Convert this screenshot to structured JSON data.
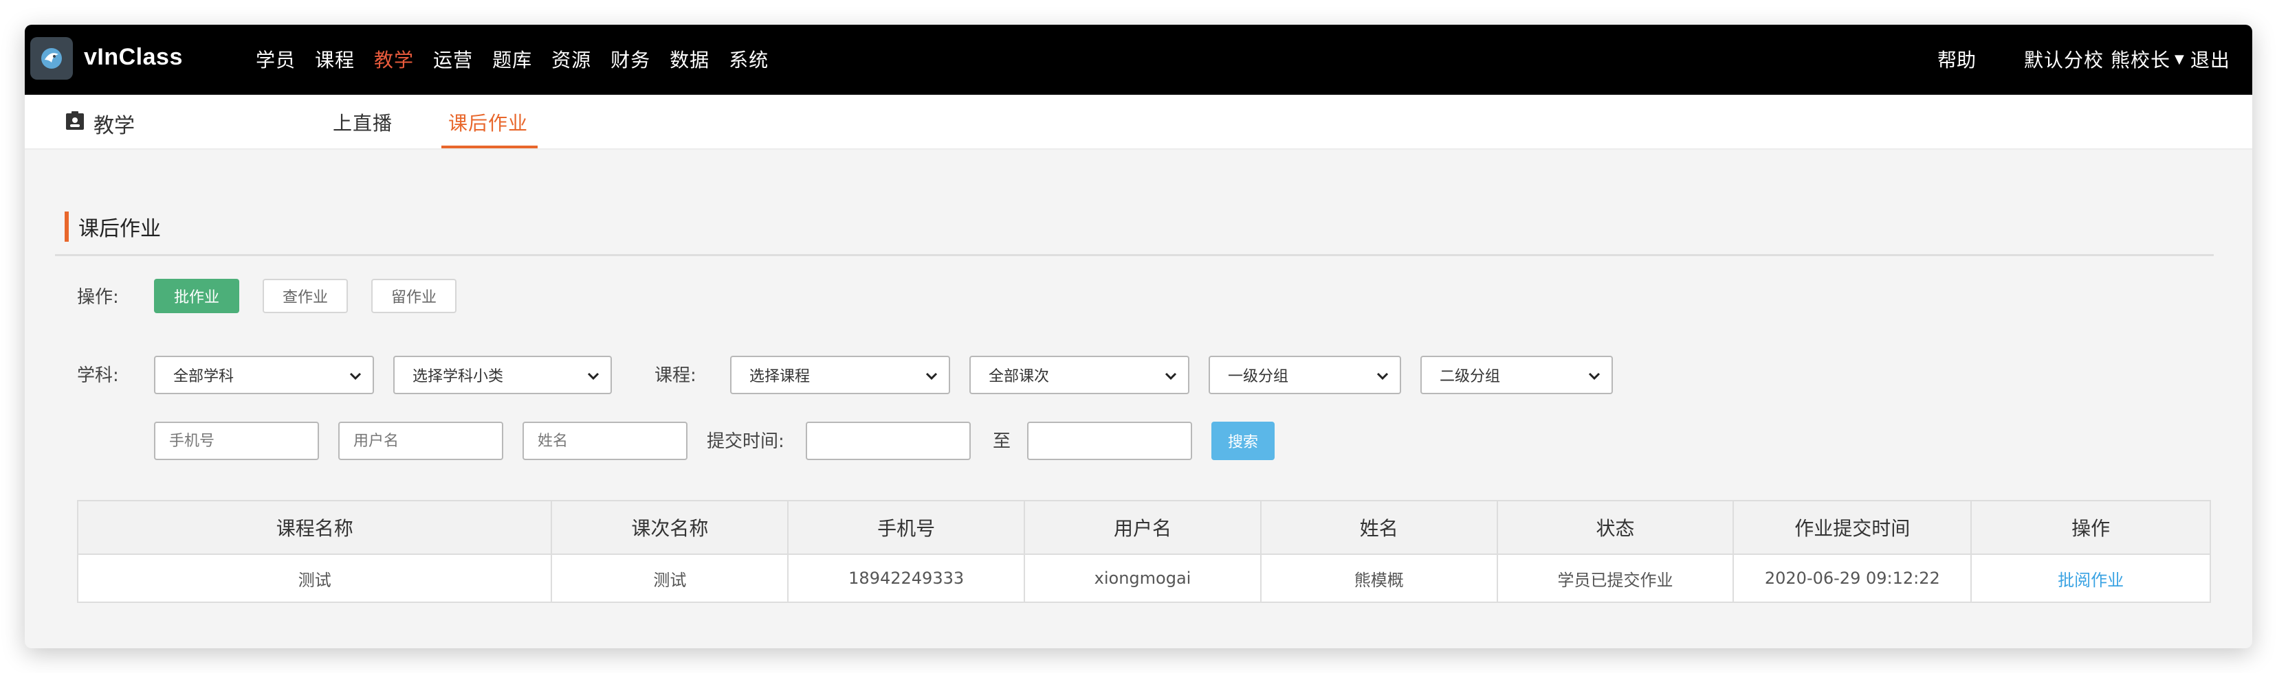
{
  "app": {
    "brand": "vInClass",
    "logo_icon": "vinclass-logo-icon"
  },
  "topnav": {
    "items": [
      "学员",
      "课程",
      "教学",
      "运营",
      "题库",
      "资源",
      "财务",
      "数据",
      "系统"
    ],
    "active_index": 2,
    "help": "帮助",
    "campus": "默认分校",
    "user": "熊校长",
    "logout": "退出"
  },
  "subnav": {
    "section_title": "教学",
    "tabs": [
      {
        "label": "上直播"
      },
      {
        "label": "课后作业"
      }
    ],
    "active_index": 1
  },
  "panel": {
    "title": "课后作业"
  },
  "operations": {
    "label": "操作:",
    "buttons": [
      "批作业",
      "查作业",
      "留作业"
    ]
  },
  "filters": {
    "subject_label": "学科:",
    "subject_select": "全部学科",
    "subcategory_select": "选择学科小类",
    "course_label": "课程:",
    "course_select": "选择课程",
    "lesson_select": "全部课次",
    "group1_select": "一级分组",
    "group2_select": "二级分组",
    "phone_placeholder": "手机号",
    "username_placeholder": "用户名",
    "name_placeholder": "姓名",
    "submit_time_label": "提交时间:",
    "to_label": "至",
    "search_button": "搜索"
  },
  "table": {
    "headers": [
      "课程名称",
      "课次名称",
      "手机号",
      "用户名",
      "姓名",
      "状态",
      "作业提交时间",
      "操作"
    ],
    "rows": [
      [
        "测试",
        "测试",
        "18942249333",
        "xiongmogai",
        "熊模概",
        "学员已提交作业",
        "2020-06-29 09:12:22",
        "批阅作业"
      ]
    ]
  },
  "colors": {
    "accent_orange": "#e8672c",
    "nav_active": "#e85a3c",
    "green": "#4caf79",
    "blue": "#5bb7e8",
    "link": "#3aa3e3"
  }
}
